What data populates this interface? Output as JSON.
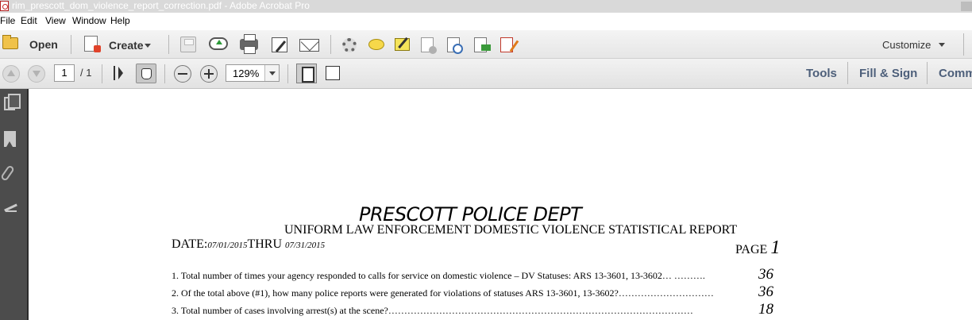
{
  "window": {
    "title": "rim_prescott_dom_violence_report_correction.pdf - Adobe Acrobat Pro"
  },
  "menu": {
    "file": "File",
    "edit": "Edit",
    "view": "View",
    "window": "Window",
    "help": "Help"
  },
  "toolbar": {
    "open_label": "Open",
    "create_label": "Create",
    "customize_label": "Customize"
  },
  "nav": {
    "current_page": "1",
    "total_pages": "/ 1",
    "zoom": "129%"
  },
  "panels": {
    "tools": "Tools",
    "fill_sign": "Fill & Sign",
    "comment": "Comm"
  },
  "document": {
    "title": "PRESCOTT POLICE DEPT",
    "subtitle": "UNIFORM LAW ENFORCEMENT DOMESTIC VIOLENCE STATISTICAL REPORT",
    "date_label": "DATE:",
    "date_from": "07/01/2015",
    "thru_label": "THRU",
    "date_to": "07/31/2015",
    "page_label": "PAGE",
    "page_number": "1",
    "questions": [
      {
        "text": "1.  Total number of times your agency responded to calls for service on domestic violence – DV Statuses:  ARS 13-3601, 13-3602… ……….",
        "answer": "36"
      },
      {
        "text": "2.  Of the total above (#1), how many police reports were generated for violations of statuses ARS 13-3601, 13-3602?…………………………",
        "answer": "36"
      },
      {
        "text": "3.  Total number of cases involving arrest(s) at the scene?……………………………………………………………………………………",
        "answer": "18"
      }
    ]
  }
}
